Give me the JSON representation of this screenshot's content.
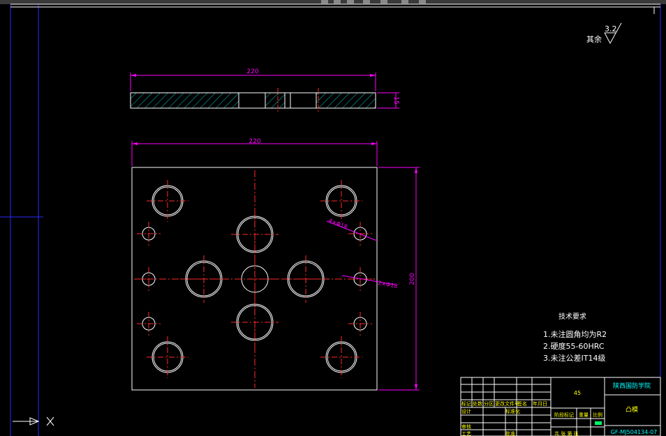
{
  "app": {
    "viewport": "CAD model space"
  },
  "colors": {
    "background": "#000000",
    "geometry": "#ffffff",
    "dimension": "#ff00ff",
    "centerline": "#ff2a2a",
    "hatch": "#00c8c8",
    "border": "#2a2aff"
  },
  "roughness": {
    "label": "其余",
    "value": "3.2"
  },
  "side_view": {
    "width_dim": "220",
    "thickness_dim": "15"
  },
  "top_view": {
    "width_dim": "220",
    "height_dim": "200",
    "hole_note_1": "4×Φ18",
    "hole_note_2": "2×Φ18"
  },
  "tech": {
    "title": "技术要求",
    "req1": "1.未注圆角均为R2",
    "req2": "2.硬度55-60HRC",
    "req3": "3.未注公差IT14级"
  },
  "title_block": {
    "material": "45",
    "school": "陕西国防学院",
    "part_name": "凸模",
    "drawing_no": "GF-MJ504134-07",
    "h1": "标记",
    "h2": "处数",
    "h3": "分区",
    "h4": "更改文件号",
    "h5": "签名",
    "h6": "年月日",
    "r_design": "设计",
    "r_std": "标准化",
    "r_stage": "阶段标记",
    "r_weight": "重量",
    "r_scale": "比例",
    "r_check": "审核",
    "r_proc": "工艺",
    "r_approve": "批准",
    "r_sheet": "共 张 第 张"
  },
  "ucs": {
    "x_label": "X"
  }
}
